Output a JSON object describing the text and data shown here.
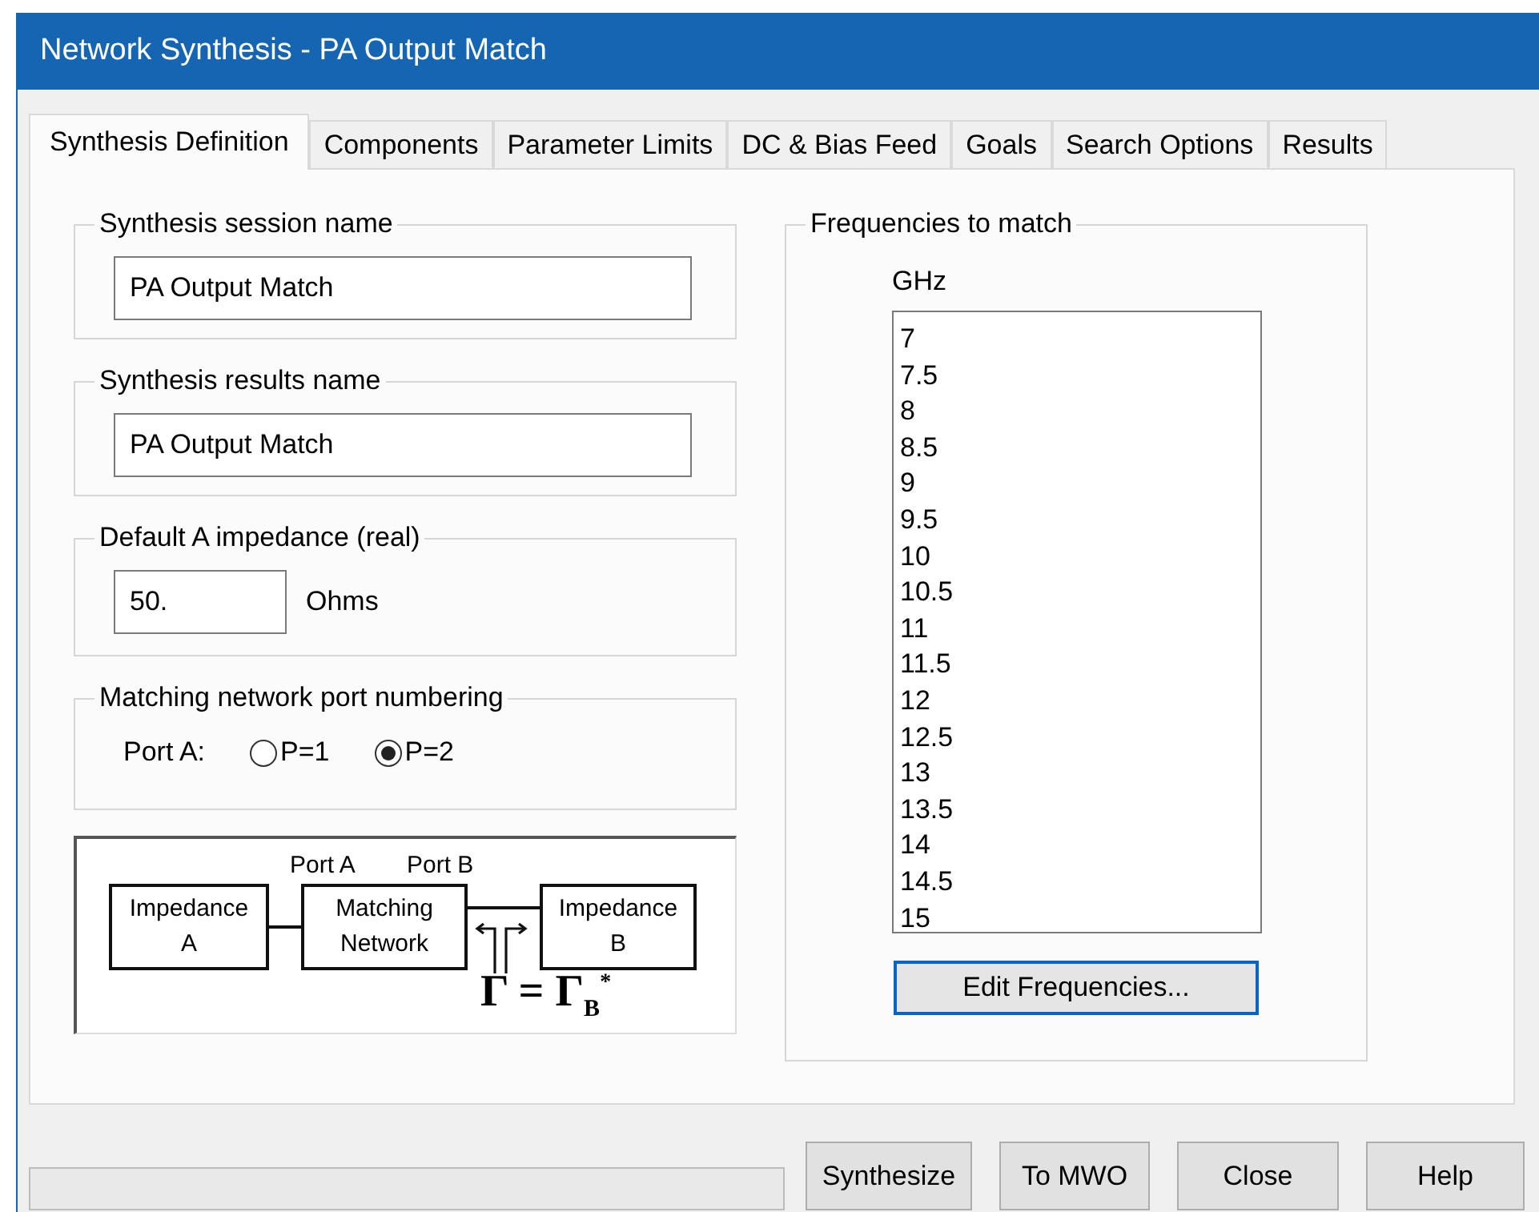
{
  "window": {
    "title": "Network Synthesis - PA Output Match"
  },
  "tabs": [
    {
      "label": "Synthesis Definition",
      "selected": true
    },
    {
      "label": "Components",
      "selected": false
    },
    {
      "label": "Parameter Limits",
      "selected": false
    },
    {
      "label": "DC & Bias Feed",
      "selected": false
    },
    {
      "label": "Goals",
      "selected": false
    },
    {
      "label": "Search Options",
      "selected": false
    },
    {
      "label": "Results",
      "selected": false
    }
  ],
  "session_name": {
    "label": "Synthesis session name",
    "value": "PA Output Match"
  },
  "results_name": {
    "label": "Synthesis results name",
    "value": "PA Output Match"
  },
  "default_impedance": {
    "label": "Default A impedance (real)",
    "value": "50.",
    "unit": "Ohms"
  },
  "port_numbering": {
    "label": "Matching network port numbering",
    "prompt": "Port A:",
    "options": [
      {
        "label": "P=1",
        "selected": false
      },
      {
        "label": "P=2",
        "selected": true
      }
    ]
  },
  "diagram": {
    "port_labels": [
      "Port A",
      "Port B"
    ],
    "blocks": [
      "Impedance A",
      "Matching Network",
      "Impedance B"
    ],
    "formula": "Γ = Γ$_{B}$$^{*}$"
  },
  "frequencies": {
    "label": "Frequencies to match",
    "unit": "GHz",
    "values": [
      "7",
      "7.5",
      "8",
      "8.5",
      "9",
      "9.5",
      "10",
      "10.5",
      "11",
      "11.5",
      "12",
      "12.5",
      "13",
      "13.5",
      "14",
      "14.5",
      "15"
    ],
    "edit_button": "Edit Frequencies..."
  },
  "buttons": [
    "Synthesize",
    "To MWO",
    "Close",
    "Help"
  ]
}
